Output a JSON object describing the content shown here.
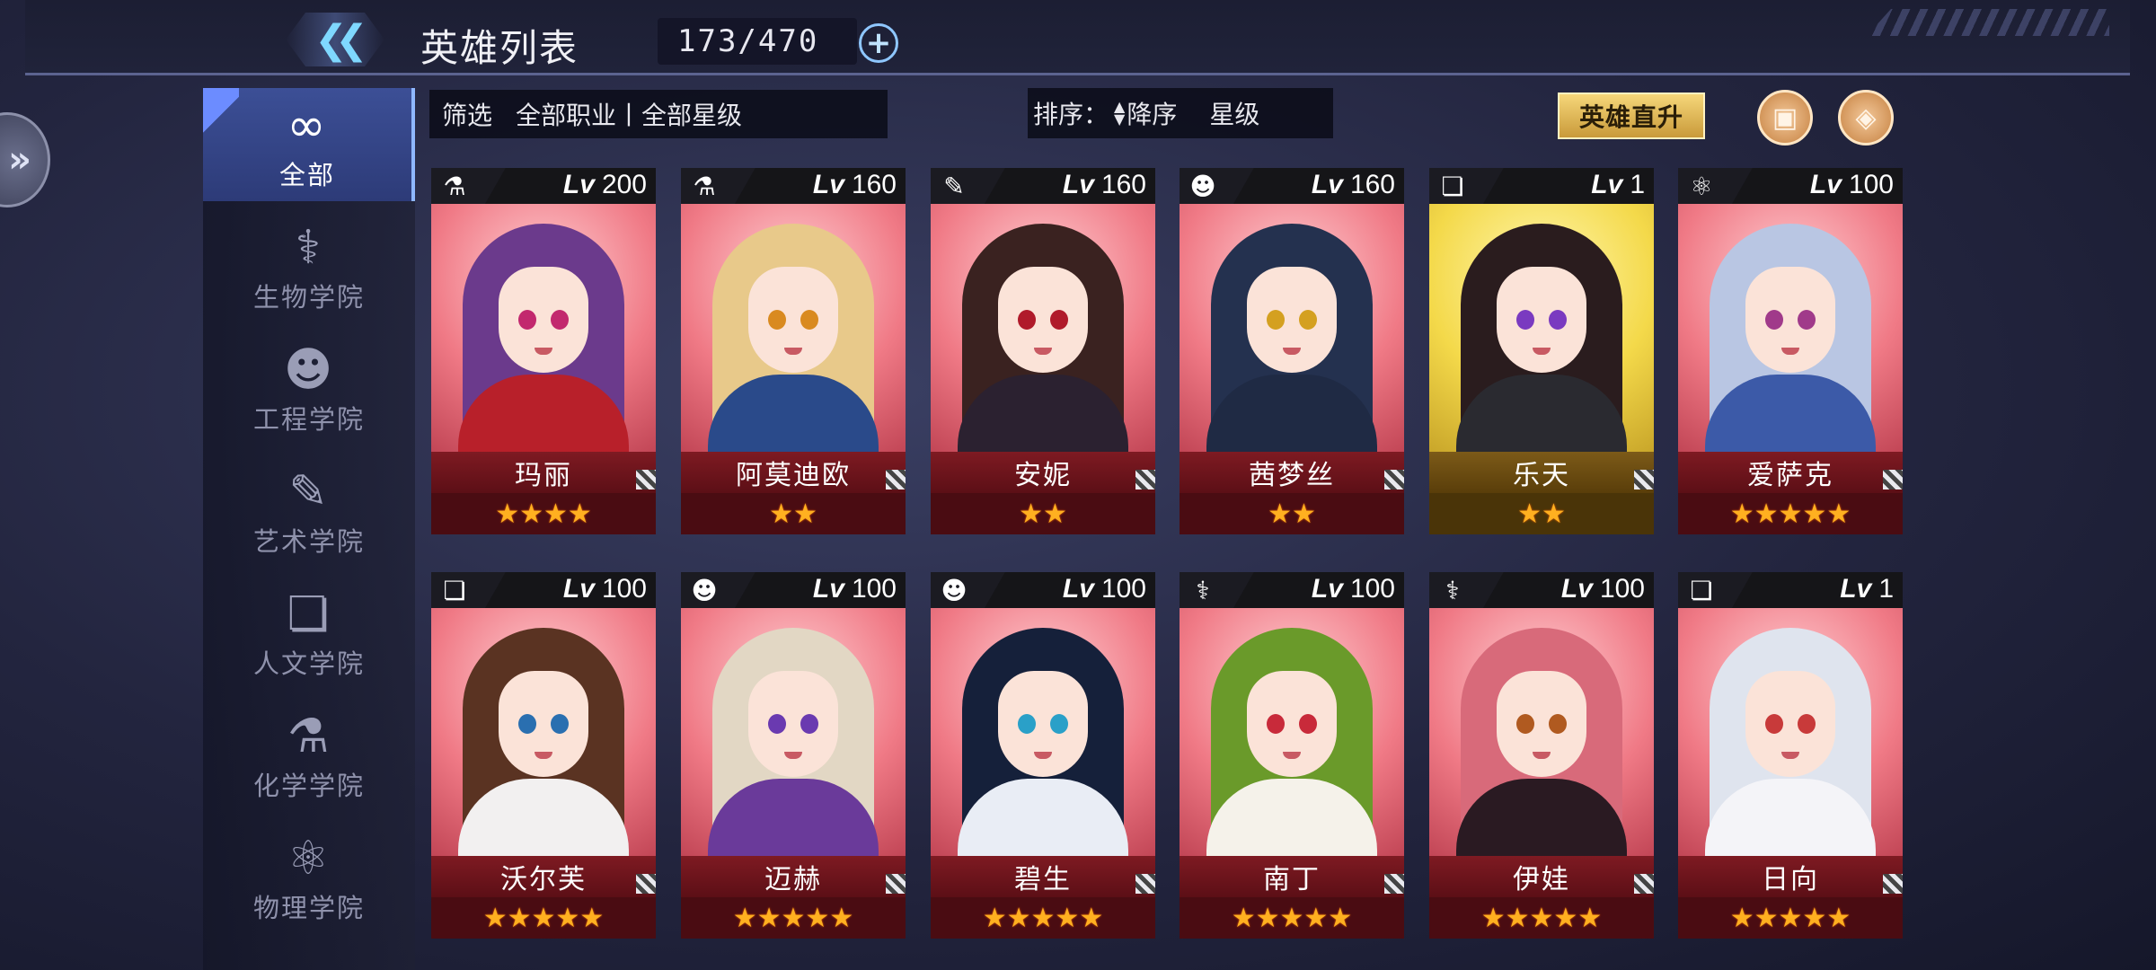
{
  "header": {
    "title": "英雄列表",
    "count": "173/470",
    "back_icon": "double-chevron-left-icon",
    "add_icon": "plus-circle-icon"
  },
  "sidebar": {
    "toggle_icon": "double-chevron-right-icon",
    "items": [
      {
        "label": "全部",
        "icon": "infinity-icon",
        "active": true
      },
      {
        "label": "生物学院",
        "icon": "dna-icon",
        "active": false
      },
      {
        "label": "工程学院",
        "icon": "robot-icon",
        "active": false
      },
      {
        "label": "艺术学院",
        "icon": "palette-icon",
        "active": false
      },
      {
        "label": "人文学院",
        "icon": "book-icon",
        "active": false
      },
      {
        "label": "化学学院",
        "icon": "flask-icon",
        "active": false
      },
      {
        "label": "物理学院",
        "icon": "atom-icon",
        "active": false
      }
    ]
  },
  "filter": {
    "label": "筛选",
    "value": "全部职业丨全部星级"
  },
  "sort": {
    "label": "排序：",
    "order": "降序",
    "key": "星级"
  },
  "actions": {
    "upgrade_label": "英雄直升",
    "icon_buttons": [
      "profile-card-icon",
      "expand-icon"
    ]
  },
  "heroes": [
    {
      "name": "玛丽",
      "level": "200",
      "class_icon": "flask-icon",
      "stars": "★★★★",
      "rarity": "red",
      "hair": "#6b3a8c",
      "eye": "#c2286e",
      "outfit": "#b8202a"
    },
    {
      "name": "阿莫迪欧",
      "level": "160",
      "class_icon": "flask-icon",
      "stars": "★★",
      "rarity": "red",
      "hair": "#e8c98a",
      "eye": "#d98a20",
      "outfit": "#2a4a8a"
    },
    {
      "name": "安妮",
      "level": "160",
      "class_icon": "palette-icon",
      "stars": "★★",
      "rarity": "red",
      "hair": "#3a2220",
      "eye": "#b01a2a",
      "outfit": "#2b2130"
    },
    {
      "name": "茜梦丝",
      "level": "160",
      "class_icon": "robot-icon",
      "stars": "★★",
      "rarity": "red",
      "hair": "#24314f",
      "eye": "#d4a020",
      "outfit": "#1f2a44"
    },
    {
      "name": "乐天",
      "level": "1",
      "class_icon": "book-icon",
      "stars": "★★",
      "rarity": "gold",
      "hair": "#2a1c1e",
      "eye": "#7a3ac0",
      "outfit": "#2a2a30"
    },
    {
      "name": "爱萨克",
      "level": "100",
      "class_icon": "atom-icon",
      "stars": "★★★★★",
      "rarity": "red",
      "hair": "#b9c6e3",
      "eye": "#a03a8a",
      "outfit": "#3c5aa8"
    },
    {
      "name": "沃尔芙",
      "level": "100",
      "class_icon": "book-icon",
      "stars": "★★★★★",
      "rarity": "red",
      "hair": "#5a3322",
      "eye": "#2a6fb0",
      "outfit": "#f2f0f0"
    },
    {
      "name": "迈赫",
      "level": "100",
      "class_icon": "robot-icon",
      "stars": "★★★★★",
      "rarity": "red",
      "hair": "#e2d7c4",
      "eye": "#6a3ab0",
      "outfit": "#6a3a9a"
    },
    {
      "name": "碧生",
      "level": "100",
      "class_icon": "robot-icon",
      "stars": "★★★★★",
      "rarity": "red",
      "hair": "#15203a",
      "eye": "#2aa0c8",
      "outfit": "#e9edf5"
    },
    {
      "name": "南丁",
      "level": "100",
      "class_icon": "dna-icon",
      "stars": "★★★★★",
      "rarity": "red",
      "hair": "#6a9a2a",
      "eye": "#c82a3a",
      "outfit": "#f5f2ea"
    },
    {
      "name": "伊娃",
      "level": "100",
      "class_icon": "dna-icon",
      "stars": "★★★★★",
      "rarity": "red",
      "hair": "#d86a7a",
      "eye": "#b05a20",
      "outfit": "#2a1a22"
    },
    {
      "name": "日向",
      "level": "1",
      "class_icon": "book-icon",
      "stars": "★★★★★",
      "rarity": "red",
      "hair": "#dfe4ee",
      "eye": "#c83a3a",
      "outfit": "#f4f4f8"
    }
  ],
  "card_lv_prefix": "Lv"
}
